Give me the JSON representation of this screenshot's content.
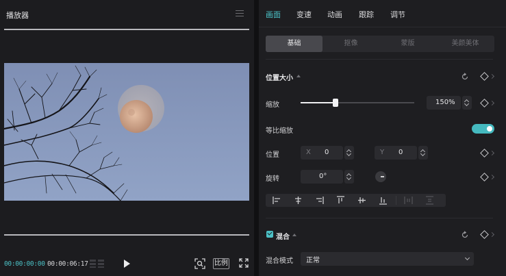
{
  "player": {
    "title": "播放器",
    "current_time": "00:00:00:00",
    "duration": "00:00:06:17",
    "ratio_label": "比例"
  },
  "inspector": {
    "tabs": [
      {
        "label": "画面",
        "active": true
      },
      {
        "label": "变速",
        "active": false
      },
      {
        "label": "动画",
        "active": false
      },
      {
        "label": "跟踪",
        "active": false
      },
      {
        "label": "调节",
        "active": false
      }
    ],
    "subtabs": [
      {
        "label": "基础",
        "active": true
      },
      {
        "label": "抠像",
        "active": false
      },
      {
        "label": "蒙版",
        "active": false
      },
      {
        "label": "美颜美体",
        "active": false
      }
    ],
    "transform": {
      "section_title": "位置大小",
      "scale_label": "缩放",
      "scale_value": "150%",
      "scale_fraction": 0.31,
      "uniform_scale_label": "等比缩放",
      "uniform_scale_on": true,
      "position_label": "位置",
      "x_axis": "X",
      "x_value": "0",
      "y_axis": "Y",
      "y_value": "0",
      "rotation_label": "旋转",
      "rotation_value": "0°"
    },
    "blend": {
      "section_title": "混合",
      "enabled": true,
      "mode_label": "混合模式",
      "mode_value": "正常"
    }
  },
  "colors": {
    "accent": "#4cc6cc",
    "panel_bg": "#1e1e21",
    "player_bg": "#1c1c1f"
  }
}
